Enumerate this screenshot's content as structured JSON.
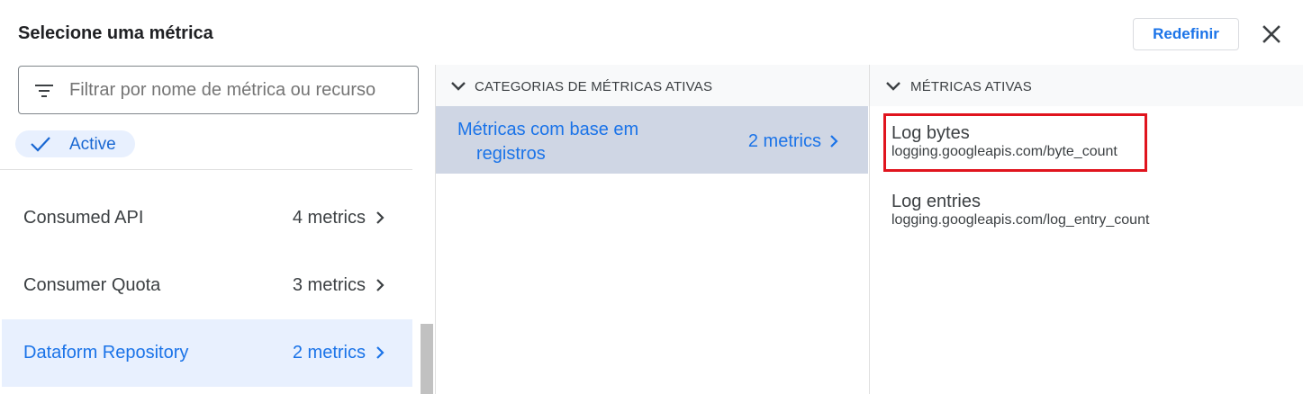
{
  "dialog": {
    "title": "Selecione uma métrica",
    "reset_label": "Redefinir",
    "close_icon": "close-icon"
  },
  "filter": {
    "placeholder": "Filtrar por nome de métrica ou recurso",
    "icon": "filter-list-icon"
  },
  "chip": {
    "label": "Active",
    "icon": "check-icon"
  },
  "resources": [
    {
      "name": "Consumed API",
      "count": "4 metrics",
      "selected": false
    },
    {
      "name": "Consumer Quota",
      "count": "3 metrics",
      "selected": false
    },
    {
      "name": "Dataform Repository",
      "count": "2 metrics",
      "selected": true
    }
  ],
  "categories": {
    "header": "CATEGORIAS DE MÉTRICAS ATIVAS",
    "items": [
      {
        "name_line1": "Métricas com base em",
        "name_line2": "registros",
        "count": "2 metrics",
        "selected": true
      }
    ]
  },
  "metrics": {
    "header": "MÉTRICAS ATIVAS",
    "items": [
      {
        "name": "Log bytes",
        "id": "logging.googleapis.com/byte_count",
        "highlighted": true
      },
      {
        "name": "Log entries",
        "id": "logging.googleapis.com/log_entry_count",
        "highlighted": false
      }
    ]
  },
  "colors": {
    "accent": "#1a73e8",
    "selected_bg": "#e8f0fe",
    "category_selected_bg": "#cfd6e4",
    "highlight_border": "#e0141e"
  }
}
